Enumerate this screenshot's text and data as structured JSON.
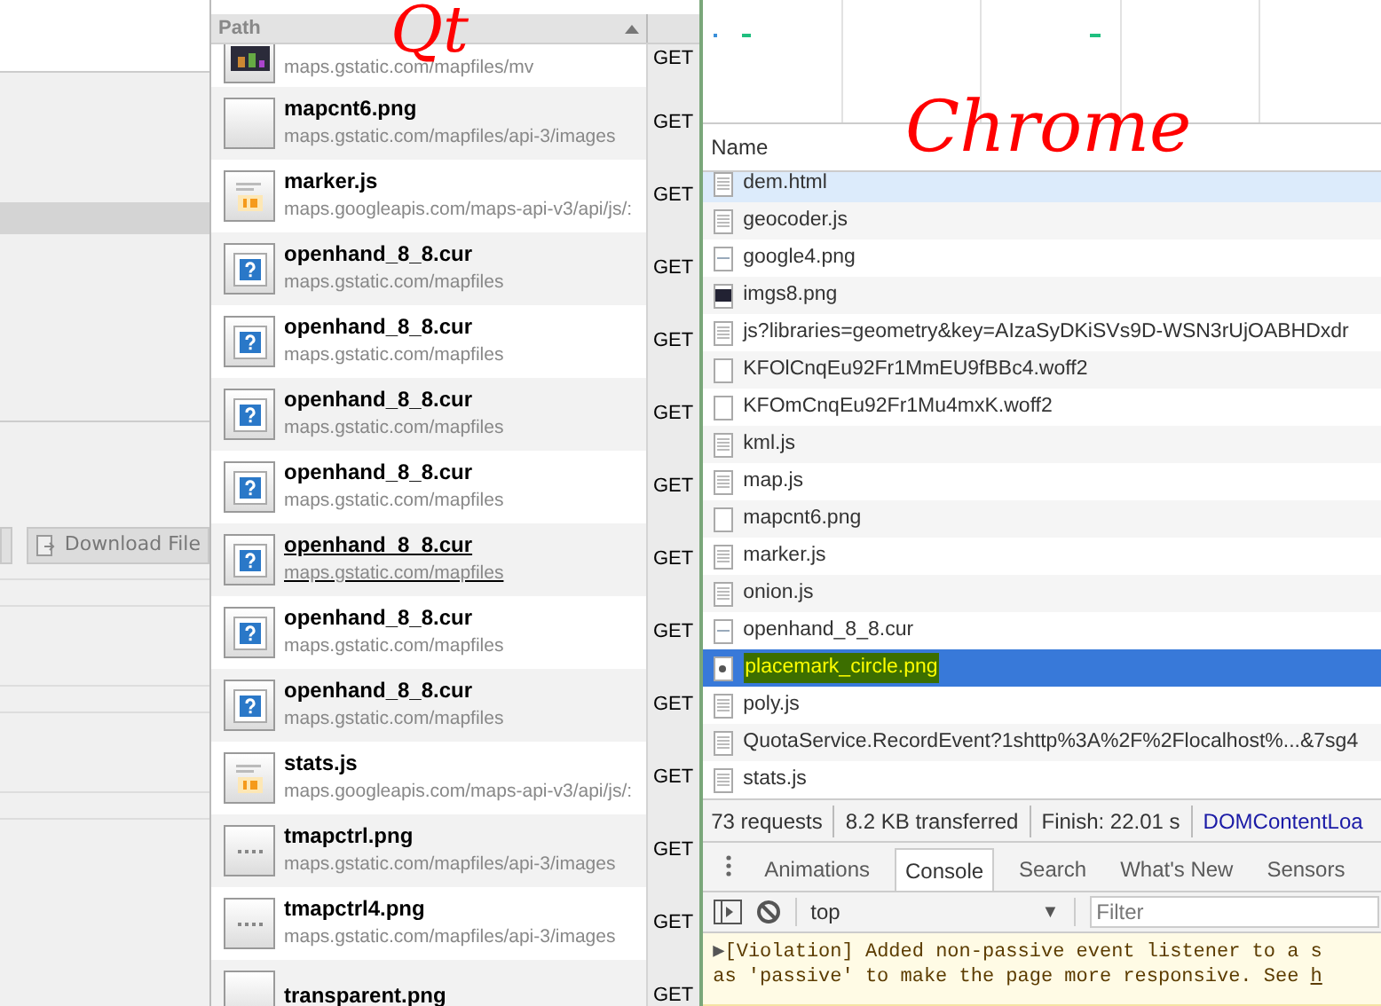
{
  "annotations": [
    {
      "text": "Qt"
    },
    {
      "text": "Chrome"
    }
  ],
  "left_panel": {
    "download_button": "Download File"
  },
  "qt_requests": {
    "header": "Path",
    "rows": [
      {
        "kind": "image",
        "name": "",
        "path": "maps.gstatic.com/mapfiles/mv",
        "method": "GET",
        "hovered": false
      },
      {
        "kind": "blank",
        "name": "mapcnt6.png",
        "path": "maps.gstatic.com/mapfiles/api-3/images",
        "method": "GET",
        "hovered": false
      },
      {
        "kind": "js",
        "name": "marker.js",
        "path": "maps.googleapis.com/maps-api-v3/api/js/:",
        "method": "GET",
        "hovered": false
      },
      {
        "kind": "unknown",
        "name": "openhand_8_8.cur",
        "path": "maps.gstatic.com/mapfiles",
        "method": "GET",
        "hovered": false
      },
      {
        "kind": "unknown",
        "name": "openhand_8_8.cur",
        "path": "maps.gstatic.com/mapfiles",
        "method": "GET",
        "hovered": false
      },
      {
        "kind": "unknown",
        "name": "openhand_8_8.cur",
        "path": "maps.gstatic.com/mapfiles",
        "method": "GET",
        "hovered": false
      },
      {
        "kind": "unknown",
        "name": "openhand_8_8.cur",
        "path": "maps.gstatic.com/mapfiles",
        "method": "GET",
        "hovered": false
      },
      {
        "kind": "unknown",
        "name": "openhand_8_8.cur",
        "path": "maps.gstatic.com/mapfiles",
        "method": "GET",
        "hovered": true
      },
      {
        "kind": "unknown",
        "name": "openhand_8_8.cur",
        "path": "maps.gstatic.com/mapfiles",
        "method": "GET",
        "hovered": false
      },
      {
        "kind": "unknown",
        "name": "openhand_8_8.cur",
        "path": "maps.gstatic.com/mapfiles",
        "method": "GET",
        "hovered": false
      },
      {
        "kind": "js",
        "name": "stats.js",
        "path": "maps.googleapis.com/maps-api-v3/api/js/:",
        "method": "GET",
        "hovered": false
      },
      {
        "kind": "dots",
        "name": "tmapctrl.png",
        "path": "maps.gstatic.com/mapfiles/api-3/images",
        "method": "GET",
        "hovered": false
      },
      {
        "kind": "dots",
        "name": "tmapctrl4.png",
        "path": "maps.gstatic.com/mapfiles/api-3/images",
        "method": "GET",
        "hovered": false
      },
      {
        "kind": "blank",
        "name": "transparent.png",
        "path": "",
        "method": "GET",
        "hovered": false
      }
    ]
  },
  "chrome_network": {
    "name_header": "Name",
    "rows": [
      {
        "kind": "doc",
        "name": "dem.html",
        "hovered": true,
        "selected": false
      },
      {
        "kind": "doc",
        "name": "geocoder.js",
        "hovered": false,
        "selected": false
      },
      {
        "kind": "image",
        "name": "google4.png",
        "hovered": false,
        "selected": false
      },
      {
        "kind": "dark",
        "name": "imgs8.png",
        "hovered": false,
        "selected": false
      },
      {
        "kind": "doc",
        "name": "js?libraries=geometry&key=AIzaSyDKiSVs9D-WSN3rUjOABHDxdr",
        "hovered": false,
        "selected": false
      },
      {
        "kind": "blank",
        "name": "KFOlCnqEu92Fr1MmEU9fBBc4.woff2",
        "hovered": false,
        "selected": false
      },
      {
        "kind": "blank",
        "name": "KFOmCnqEu92Fr1Mu4mxK.woff2",
        "hovered": false,
        "selected": false
      },
      {
        "kind": "doc",
        "name": "kml.js",
        "hovered": false,
        "selected": false
      },
      {
        "kind": "doc",
        "name": "map.js",
        "hovered": false,
        "selected": false
      },
      {
        "kind": "blank",
        "name": "mapcnt6.png",
        "hovered": false,
        "selected": false
      },
      {
        "kind": "doc",
        "name": "marker.js",
        "hovered": false,
        "selected": false
      },
      {
        "kind": "doc",
        "name": "onion.js",
        "hovered": false,
        "selected": false
      },
      {
        "kind": "image",
        "name": "openhand_8_8.cur",
        "hovered": false,
        "selected": false
      },
      {
        "kind": "dot",
        "name": "placemark_circle.png",
        "hovered": false,
        "selected": true
      },
      {
        "kind": "doc",
        "name": "poly.js",
        "hovered": false,
        "selected": false
      },
      {
        "kind": "doc",
        "name": "QuotaService.RecordEvent?1shttp%3A%2F%2Flocalhost%...&7sg4",
        "hovered": false,
        "selected": false
      },
      {
        "kind": "doc",
        "name": "stats.js",
        "hovered": false,
        "selected": false
      }
    ],
    "status": [
      {
        "kind": "text",
        "text": "73 requests"
      },
      {
        "kind": "text",
        "text": "8.2 KB transferred"
      },
      {
        "kind": "text",
        "text": "Finish: 22.01 s"
      },
      {
        "kind": "link",
        "text": "DOMContentLoa"
      }
    ]
  },
  "drawer": {
    "tabs": [
      {
        "label": "Animations",
        "selected": false
      },
      {
        "label": "Console",
        "selected": true
      },
      {
        "label": "Search",
        "selected": false
      },
      {
        "label": "What's New",
        "selected": false
      },
      {
        "label": "Sensors",
        "selected": false
      }
    ],
    "context": "top",
    "context_arrow": "▼",
    "filter_placeholder": "Filter",
    "message": {
      "arrow": "▶",
      "line1": "[Violation] Added non-passive event listener to a s",
      "line2": "as 'passive' to make the page more responsive. See ",
      "link": "h"
    }
  }
}
